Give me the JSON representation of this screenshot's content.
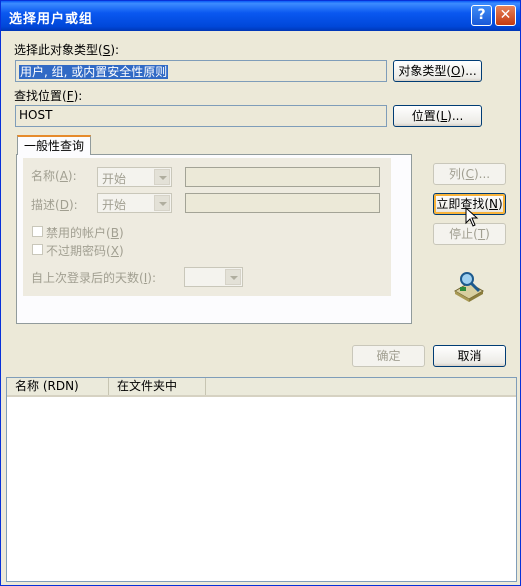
{
  "window": {
    "title": "选择用户或组"
  },
  "object_type": {
    "label_prefix": "选择此对象类型",
    "label_key": "S",
    "label_suffix": ":",
    "value": "用户, 组, 或内置安全性原则",
    "button_prefix": "对象类型",
    "button_key": "O",
    "button_suffix": "..."
  },
  "location": {
    "label_prefix": "查找位置",
    "label_key": "F",
    "label_suffix": ":",
    "value": "HOST",
    "button_prefix": "位置",
    "button_key": "L",
    "button_suffix": "..."
  },
  "tab": {
    "label": "一般性查询"
  },
  "query": {
    "name_label": "名称",
    "name_key": "A",
    "name_mode": "开始",
    "desc_label": "描述",
    "desc_key": "D",
    "desc_mode": "开始",
    "disabled_accounts_label": "禁用的帐户",
    "disabled_accounts_key": "B",
    "no_expire_label": "不过期密码",
    "no_expire_key": "X",
    "days_label": "自上次登录后的天数",
    "days_key": "I",
    "colon": ":"
  },
  "side_buttons": {
    "columns_label": "列",
    "columns_key": "C",
    "columns_suffix": "...",
    "find_label": "立即查找",
    "find_key": "N",
    "stop_label": "停止",
    "stop_key": "T"
  },
  "dialog_buttons": {
    "ok": "确定",
    "cancel": "取消"
  },
  "results": {
    "columns": [
      "名称 (RDN)",
      "在文件夹中"
    ]
  },
  "icons": [
    "help-icon",
    "close-icon",
    "search-users-icon",
    "mouse-cursor-icon"
  ]
}
